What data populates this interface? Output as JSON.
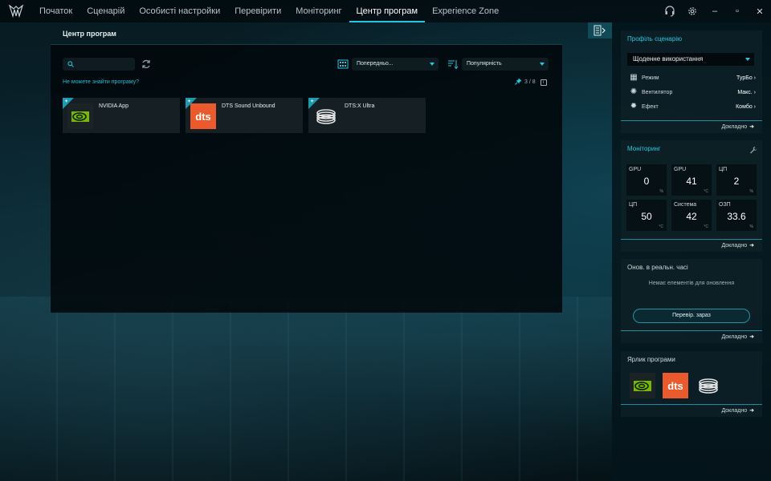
{
  "nav": {
    "items": [
      "Початок",
      "Сценарій",
      "Особисті настройки",
      "Перевірити",
      "Моніторинг",
      "Центр програм",
      "Experience Zone"
    ],
    "active_index": 5
  },
  "window": {
    "minimize": "–",
    "restore": "▫",
    "close": "✕"
  },
  "main": {
    "title": "Центр програм",
    "search_placeholder": "",
    "help_link": "Не можете знайти програму?",
    "view_select": "Попередньо...",
    "sort_select": "Популярність",
    "pinned_count": "3 / 8",
    "info": "i",
    "apps": [
      {
        "name": "NVIDIA App",
        "icon": "nvidia-icon"
      },
      {
        "name": "DTS Sound Unbound",
        "icon": "dts-icon"
      },
      {
        "name": "DTS:X Ultra",
        "icon": "dtsx-icon"
      }
    ]
  },
  "profile": {
    "title": "Профіль сценарію",
    "selected": "Щоденне використання",
    "rows": [
      {
        "label": "Режим",
        "value": "ТурБо",
        "icon": "mode-icon"
      },
      {
        "label": "Вентилятор",
        "value": "Макс.",
        "icon": "fan-icon"
      },
      {
        "label": "Ефект",
        "value": "Комбо",
        "icon": "effect-icon"
      }
    ],
    "more": "Докладно"
  },
  "monitoring": {
    "title": "Моніторинг",
    "tiles": [
      {
        "label": "GPU",
        "value": "0",
        "unit": "%"
      },
      {
        "label": "GPU",
        "value": "41",
        "unit": "°C"
      },
      {
        "label": "ЦП",
        "value": "2",
        "unit": "%"
      },
      {
        "label": "ЦП",
        "value": "50",
        "unit": "°C"
      },
      {
        "label": "Система",
        "value": "42",
        "unit": "°C"
      },
      {
        "label": "ОЗП",
        "value": "33.6",
        "unit": "%"
      }
    ],
    "more": "Докладно"
  },
  "updates": {
    "title": "Онов. в реальн. часі",
    "empty": "Немає елементів для оновлення",
    "button": "Перевір. зараз",
    "more": "Докладно"
  },
  "shortcuts": {
    "title": "Ярлик програми",
    "icons": [
      "nvidia-icon",
      "dts-icon",
      "dtsx-icon"
    ],
    "more": "Докладно"
  },
  "colors": {
    "accent": "#21c8e0",
    "dts": "#ea5a2c",
    "nvidia": "#76b900"
  }
}
